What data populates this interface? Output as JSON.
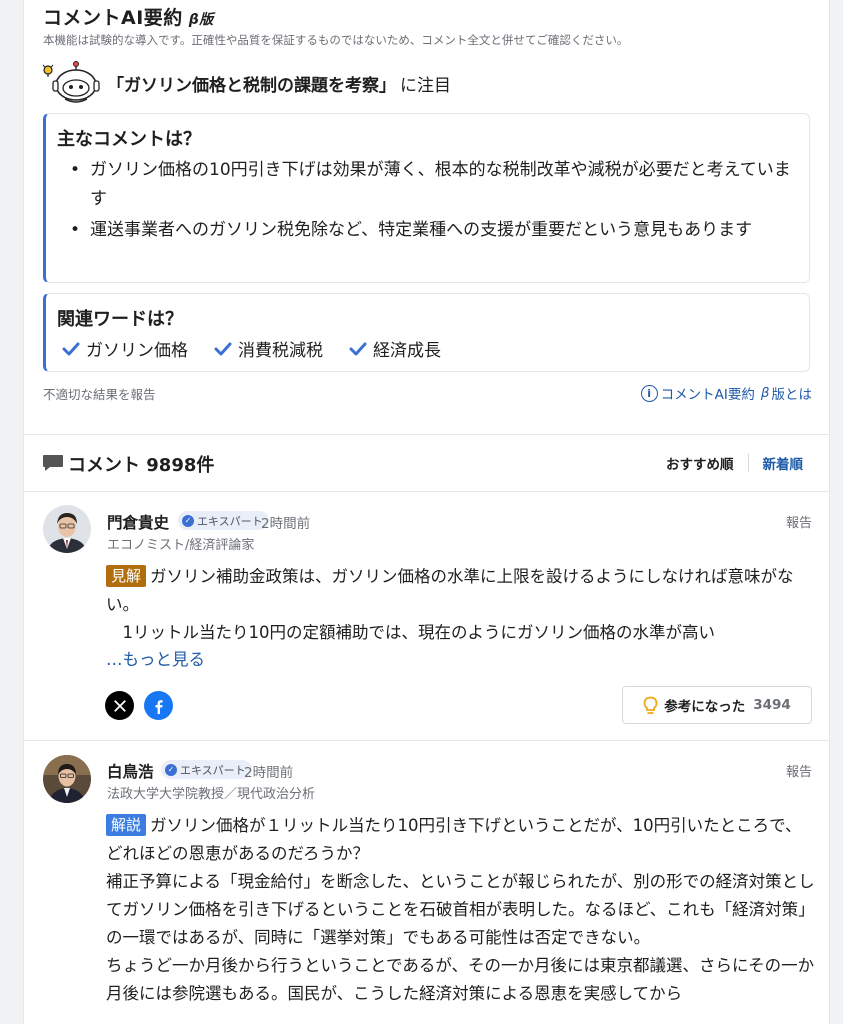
{
  "ai_summary": {
    "title": "コメントAI要約",
    "beta": "β版",
    "disclaimer": "本機能は試験的な導入です。正確性や品質を保証するものではないため、コメント全文と併せてご確認ください。",
    "topic_main": "「ガソリン価格と税制の課題を考察」",
    "topic_suffix": "に注目",
    "main_heading": "主なコメントは？",
    "main_points": [
      "ガソリン価格の10円引き下げは効果が薄く、根本的な税制改革や減税が必要だと考えています",
      "運送事業者へのガソリン税免除など、特定業種への支援が重要だという意見もあります"
    ],
    "words_heading": "関連ワードは？",
    "words": [
      "ガソリン価格",
      "消費税減税",
      "経済成長"
    ],
    "report_link": "不適切な結果を報告",
    "about_link_prefix": "コメントAI要約",
    "about_link_beta": "β",
    "about_link_suffix": "版とは"
  },
  "comments_header": {
    "title": "コメント 9898件",
    "sort_recommended": "おすすめ順",
    "sort_newest": "新着順"
  },
  "comments": [
    {
      "name": "門倉貴史",
      "badge": "エキスパート",
      "time": "2時間前",
      "report": "報告",
      "role": "エコノミスト/経済評論家",
      "tag": "見解",
      "text": "ガソリン補助金政策は、ガソリン価格の水準に上限を設けるようにしなければ意味がない。\n　1リットル当たり10円の定額補助では、現在のようにガソリン価格の水準が高い",
      "more": "…もっと見る",
      "helpful_label": "参考になった",
      "helpful_count": "3494"
    },
    {
      "name": "白鳥浩",
      "badge": "エキスパート",
      "time": "2時間前",
      "report": "報告",
      "role": "法政大学大学院教授／現代政治分析",
      "tag": "解説",
      "text": "ガソリン価格が１リットル当たり10円引き下げということだが、10円引いたところで、どれほどの恩恵があるのだろうか？\n補正予算による「現金給付」を断念した、ということが報じられたが、別の形での経済対策としてガソリン価格を引き下げるということを石破首相が表明した。なるほど、これも「経済対策」の一環ではあるが、同時に「選挙対策」でもある可能性は否定できない。\nちょうど一か月後から行うということであるが、その一か月後には東京都議選、さらにその一か月後には参院選もある。国民が、こうした経済対策による恩恵を実感してから"
    }
  ]
}
